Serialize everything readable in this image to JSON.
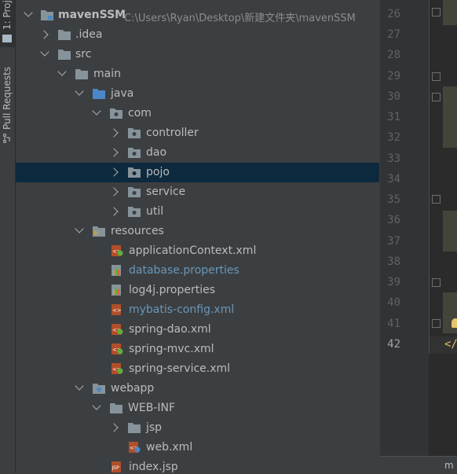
{
  "tool_strip": {
    "project_tab": "1: Proj",
    "pull_requests_tab": "Pull Requests"
  },
  "tree": {
    "root": {
      "name": "mavenSSM",
      "path": "C:\\Users\\Ryan\\Desktop\\新建文件夹\\mavenSSM"
    },
    "idea": ".idea",
    "src": "src",
    "main": "main",
    "java": "java",
    "com": "com",
    "packages": [
      "controller",
      "dao",
      "pojo",
      "service",
      "util"
    ],
    "resources": "resources",
    "resource_files": [
      {
        "name": "applicationContext.xml",
        "kind": "spring-xml",
        "color": "#bbbbbb"
      },
      {
        "name": "database.properties",
        "kind": "properties",
        "color": "#6897bb"
      },
      {
        "name": "log4j.properties",
        "kind": "properties",
        "color": "#bbbbbb"
      },
      {
        "name": "mybatis-config.xml",
        "kind": "xml",
        "color": "#6897bb"
      },
      {
        "name": "spring-dao.xml",
        "kind": "spring-xml",
        "color": "#bbbbbb"
      },
      {
        "name": "spring-mvc.xml",
        "kind": "spring-xml",
        "color": "#bbbbbb"
      },
      {
        "name": "spring-service.xml",
        "kind": "spring-xml",
        "color": "#bbbbbb"
      }
    ],
    "webapp": "webapp",
    "web_inf": "WEB-INF",
    "jsp": "jsp",
    "web_xml": "web.xml",
    "index_jsp": "index.jsp",
    "selected_item": "pojo"
  },
  "editor": {
    "line_numbers": [
      "26",
      "27",
      "28",
      "29",
      "30",
      "31",
      "32",
      "33",
      "34",
      "35",
      "36",
      "37",
      "38",
      "39",
      "40",
      "41",
      "42"
    ],
    "current_line": "42",
    "closing_text": "</",
    "tab_label": "m"
  },
  "colors": {
    "panel_bg": "#3c3f41",
    "selection_bg": "#0d293e",
    "folder_blue": "#6897bb",
    "editor_bg": "#2b2b2b"
  }
}
